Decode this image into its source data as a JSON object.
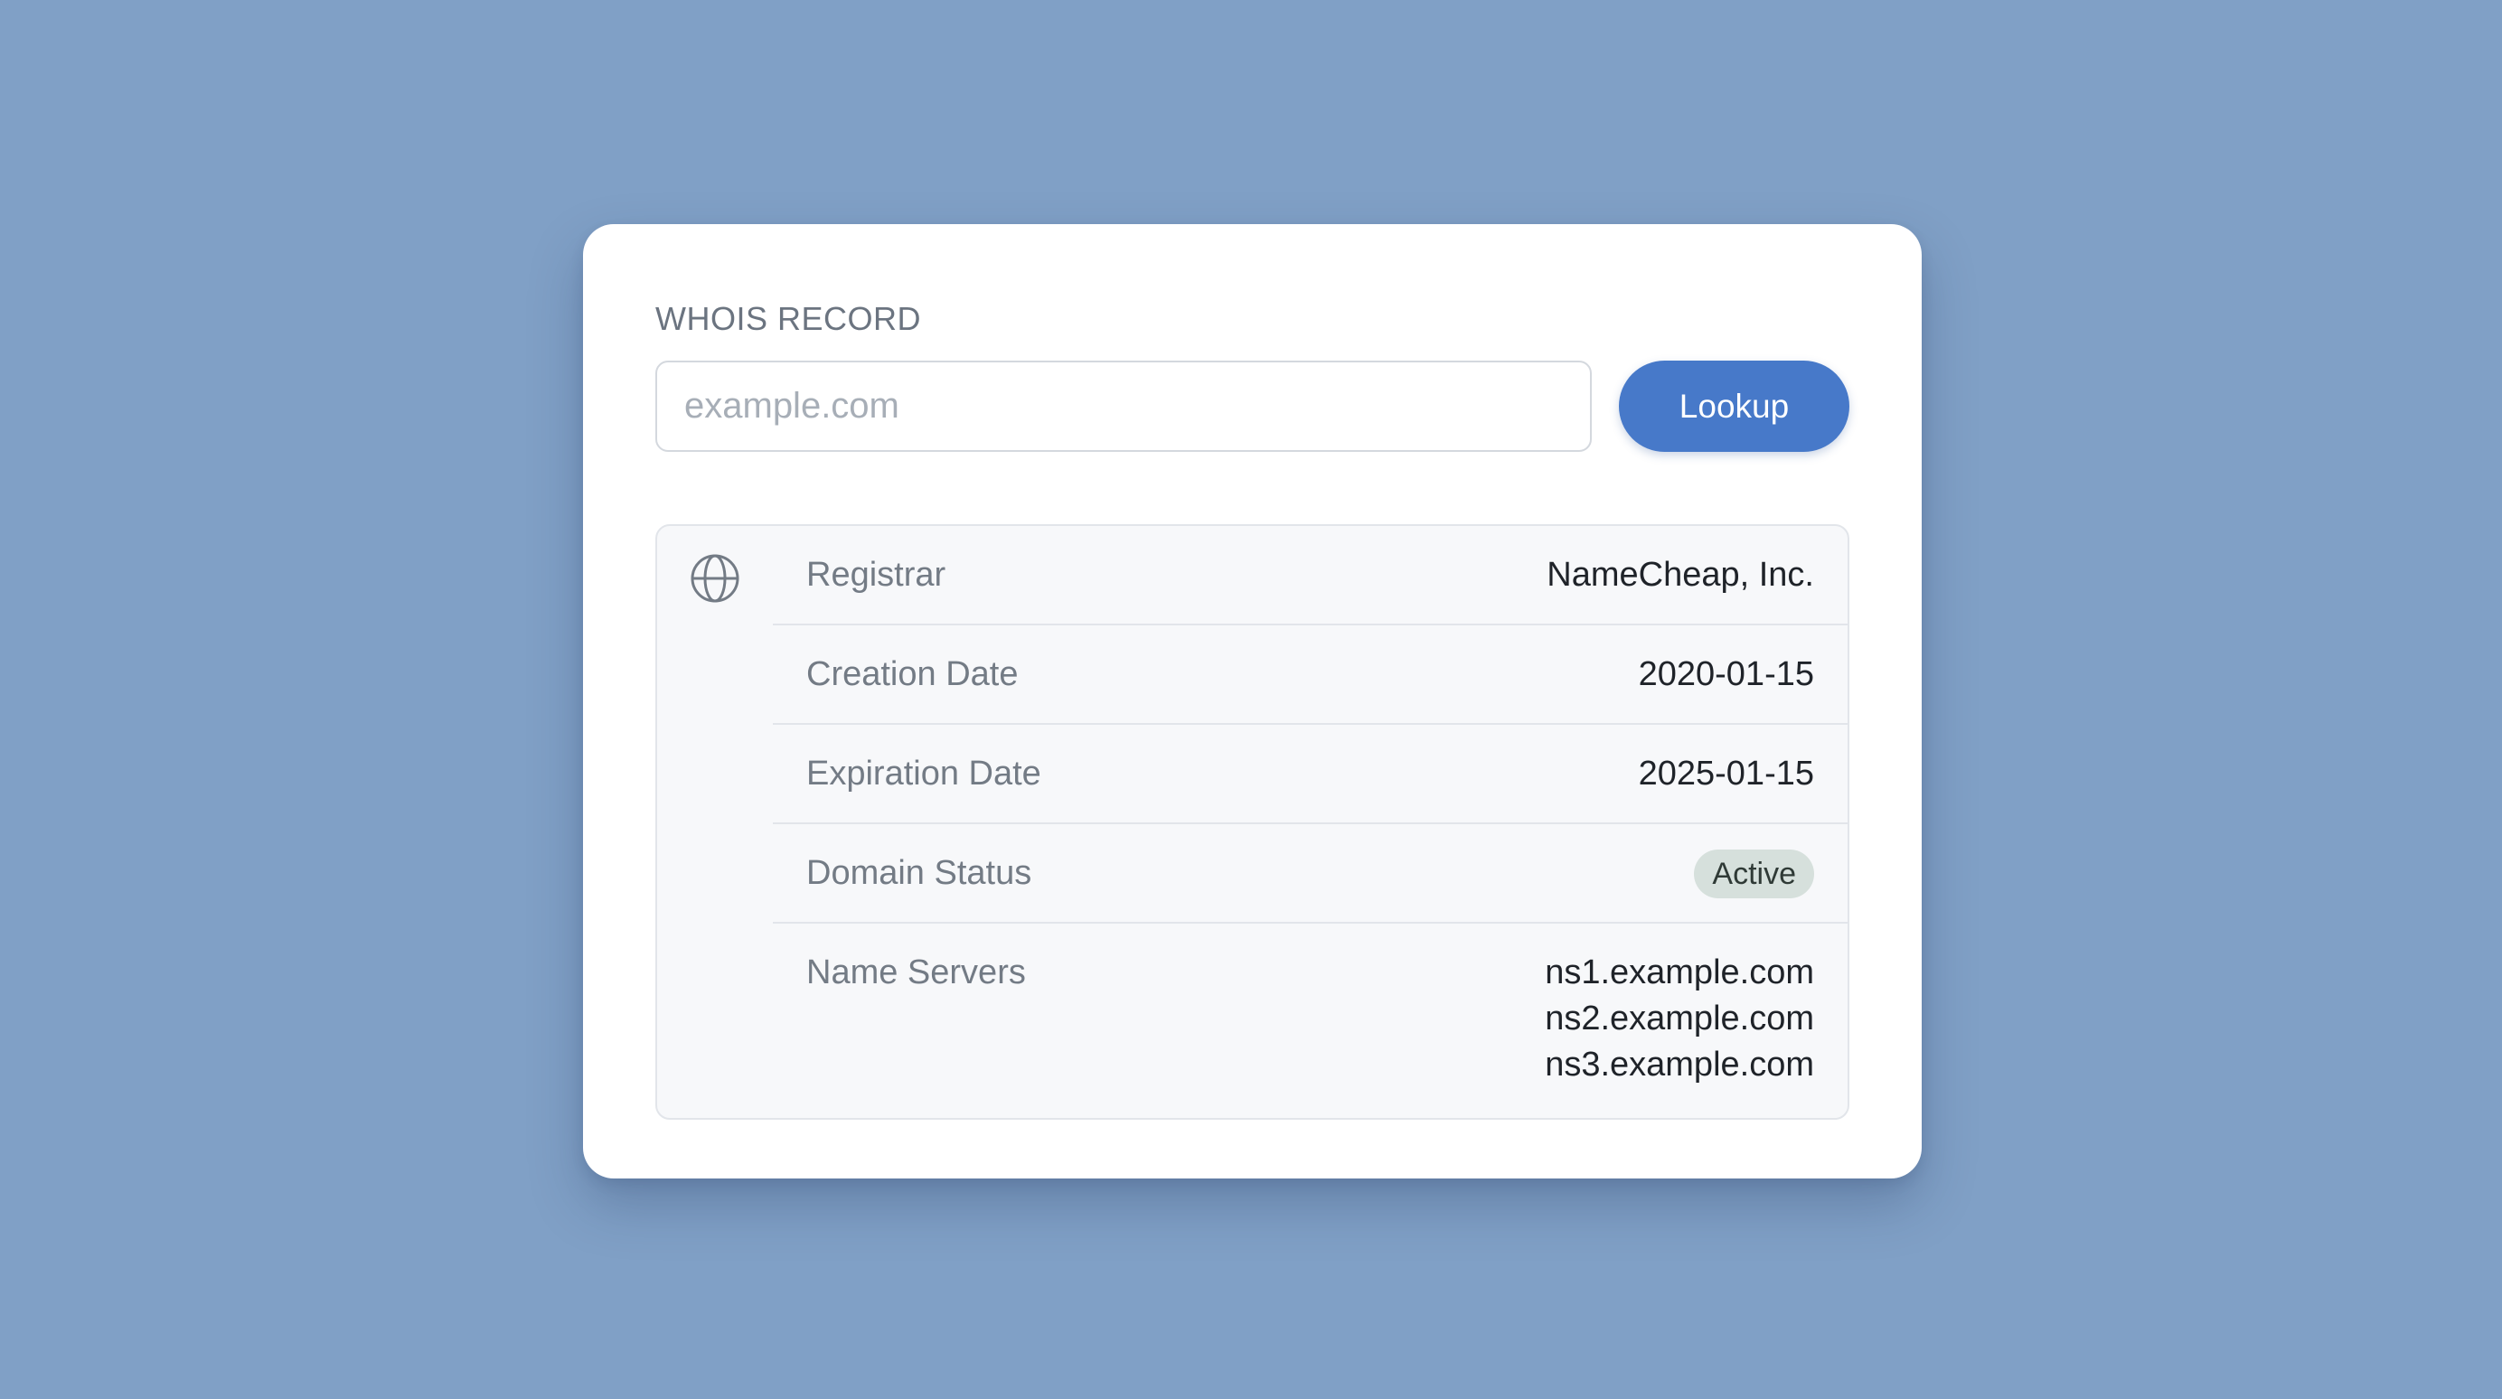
{
  "whois": {
    "section_label": "WHOIS RECORD",
    "search": {
      "placeholder": "example.com",
      "value": ""
    },
    "lookup_label": "Lookup",
    "icon": "globe-icon",
    "rows": [
      {
        "label": "Registrar",
        "value": "NameCheap, Inc."
      },
      {
        "label": "Creation Date",
        "value": "2020-01-15"
      },
      {
        "label": "Expiration Date",
        "value": "2025-01-15"
      },
      {
        "label": "Domain Status",
        "value": "Active"
      },
      {
        "label": "Name Servers",
        "values": [
          "ns1.example.com",
          "ns2.example.com",
          "ns3.example.com"
        ]
      }
    ]
  },
  "colors": {
    "background": "#80a0c6",
    "accent": "#4779c9",
    "status_badge": "#d6e0dc"
  }
}
